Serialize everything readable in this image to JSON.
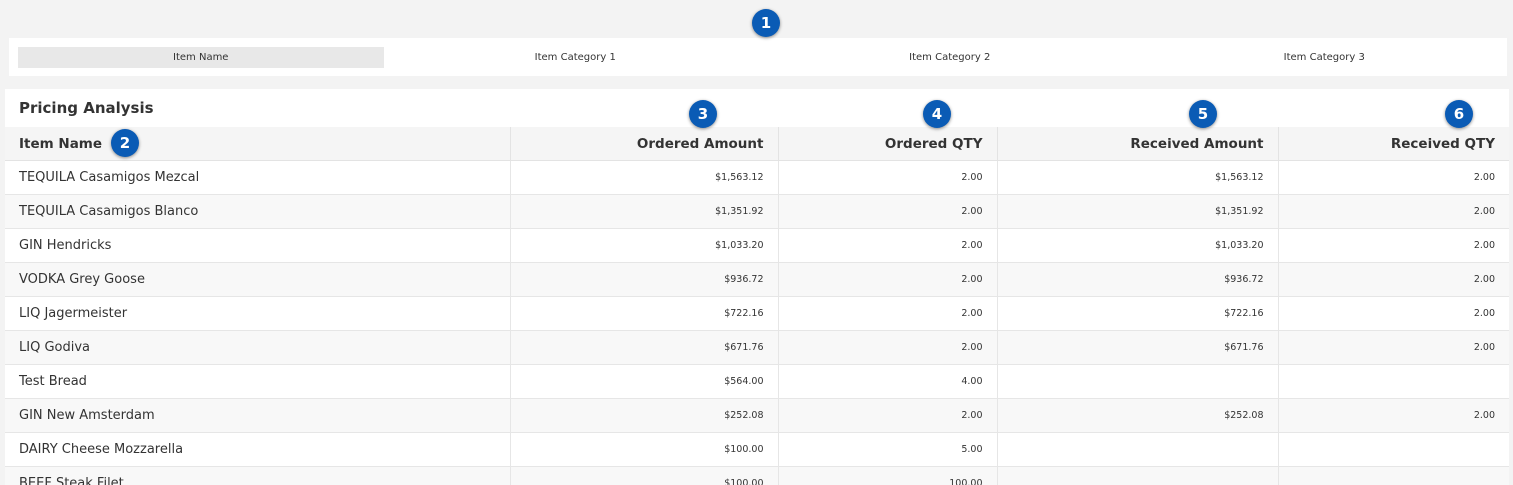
{
  "tabs": [
    "Item Name",
    "Item Category 1",
    "Item Category 2",
    "Item Category 3"
  ],
  "markers": [
    "1",
    "2",
    "3",
    "4",
    "5",
    "6"
  ],
  "panel_title": "Pricing Analysis",
  "columns": [
    "Item Name",
    "Ordered Amount",
    "Ordered QTY",
    "Received Amount",
    "Received QTY"
  ],
  "rows": [
    [
      "TEQUILA Casamigos Mezcal",
      "$1,563.12",
      "2.00",
      "$1,563.12",
      "2.00"
    ],
    [
      "TEQUILA Casamigos Blanco",
      "$1,351.92",
      "2.00",
      "$1,351.92",
      "2.00"
    ],
    [
      "GIN Hendricks",
      "$1,033.20",
      "2.00",
      "$1,033.20",
      "2.00"
    ],
    [
      "VODKA Grey Goose",
      "$936.72",
      "2.00",
      "$936.72",
      "2.00"
    ],
    [
      "LIQ Jagermeister",
      "$722.16",
      "2.00",
      "$722.16",
      "2.00"
    ],
    [
      "LIQ Godiva",
      "$671.76",
      "2.00",
      "$671.76",
      "2.00"
    ],
    [
      "Test Bread",
      "$564.00",
      "4.00",
      "",
      ""
    ],
    [
      "GIN New Amsterdam",
      "$252.08",
      "2.00",
      "$252.08",
      "2.00"
    ],
    [
      "DAIRY Cheese Mozzarella",
      "$100.00",
      "5.00",
      "",
      ""
    ],
    [
      "BEEF Steak Filet",
      "$100.00",
      "100.00",
      "",
      ""
    ]
  ],
  "colors": {
    "marker": "#0a5bb5",
    "header_bg": "#f5f5f5",
    "active_tab": "#e8e8e8"
  }
}
